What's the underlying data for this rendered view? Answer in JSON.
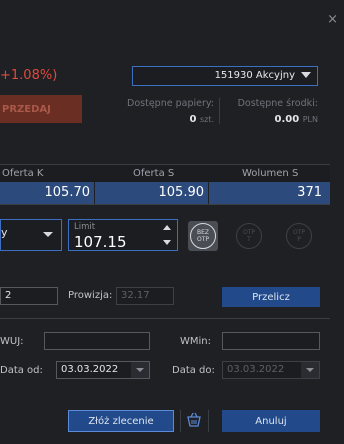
{
  "window": {
    "close_glyph": "×"
  },
  "instrument": {
    "change_text": "+1.08%)",
    "account": "151930 Akcyjny"
  },
  "sell": {
    "label": "PRZEDAJ"
  },
  "availability": {
    "papers_label": "Dostępne papiery:",
    "papers_value": "0",
    "papers_unit": "szt.",
    "funds_label": "Dostępne środki:",
    "funds_value": "0.00",
    "funds_unit": "PLN"
  },
  "quotes": {
    "headers": [
      "Oferta K",
      "Oferta S",
      "Wolumen S"
    ],
    "values": [
      "105.70",
      "105.90",
      "371"
    ]
  },
  "order": {
    "type_partial": "y",
    "limit_label": "Limit",
    "limit_value": "107.15",
    "bez_otp_label_1": "BEZ",
    "bez_otp_label_2": "OTP",
    "otp_t_1": "OTP",
    "otp_t_2": "T",
    "otp_p_1": "OTP",
    "otp_p_2": "P"
  },
  "calc": {
    "left_value": "2",
    "commission_label": "Prowizja:",
    "commission_value": "32.17",
    "recalc_label": "Przelicz"
  },
  "params": {
    "wuj_label": "WUJ:",
    "wuj_value": "",
    "wmin_label": "WMin:",
    "wmin_value": "",
    "date_from_label": "Data od:",
    "date_from_value": "03.03.2022",
    "date_to_label": "Data do:",
    "date_to_value": "03.03.2022"
  },
  "footer": {
    "submit_label": "Złóż zlecenie",
    "cancel_label": "Anuluj",
    "basket_icon": "basket-icon"
  }
}
